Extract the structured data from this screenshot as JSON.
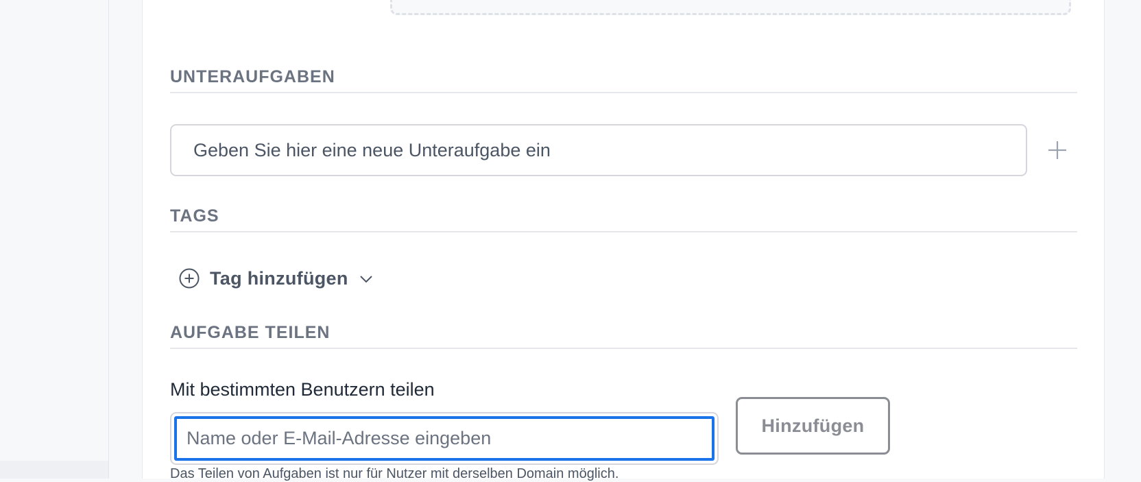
{
  "sections": {
    "subtasks": {
      "title": "UNTERAUFGABEN",
      "input_placeholder": "Geben Sie hier eine neue Unteraufgabe ein"
    },
    "tags": {
      "title": "TAGS",
      "add_label": "Tag hinzufügen"
    },
    "share": {
      "title": "AUFGABE TEILEN",
      "label": "Mit bestimmten Benutzern teilen",
      "input_placeholder": "Name oder E-Mail-Adresse eingeben",
      "button_label": "Hinzufügen",
      "hint": "Das Teilen von Aufgaben ist nur für Nutzer mit derselben Domain möglich."
    }
  },
  "icons": {
    "add_subtask": "plus-icon",
    "add_tag": "plus-circle-icon",
    "tag_dropdown": "chevron-down-icon"
  },
  "colors": {
    "focus_border": "#1a73e8",
    "section_title": "#6b7280"
  }
}
